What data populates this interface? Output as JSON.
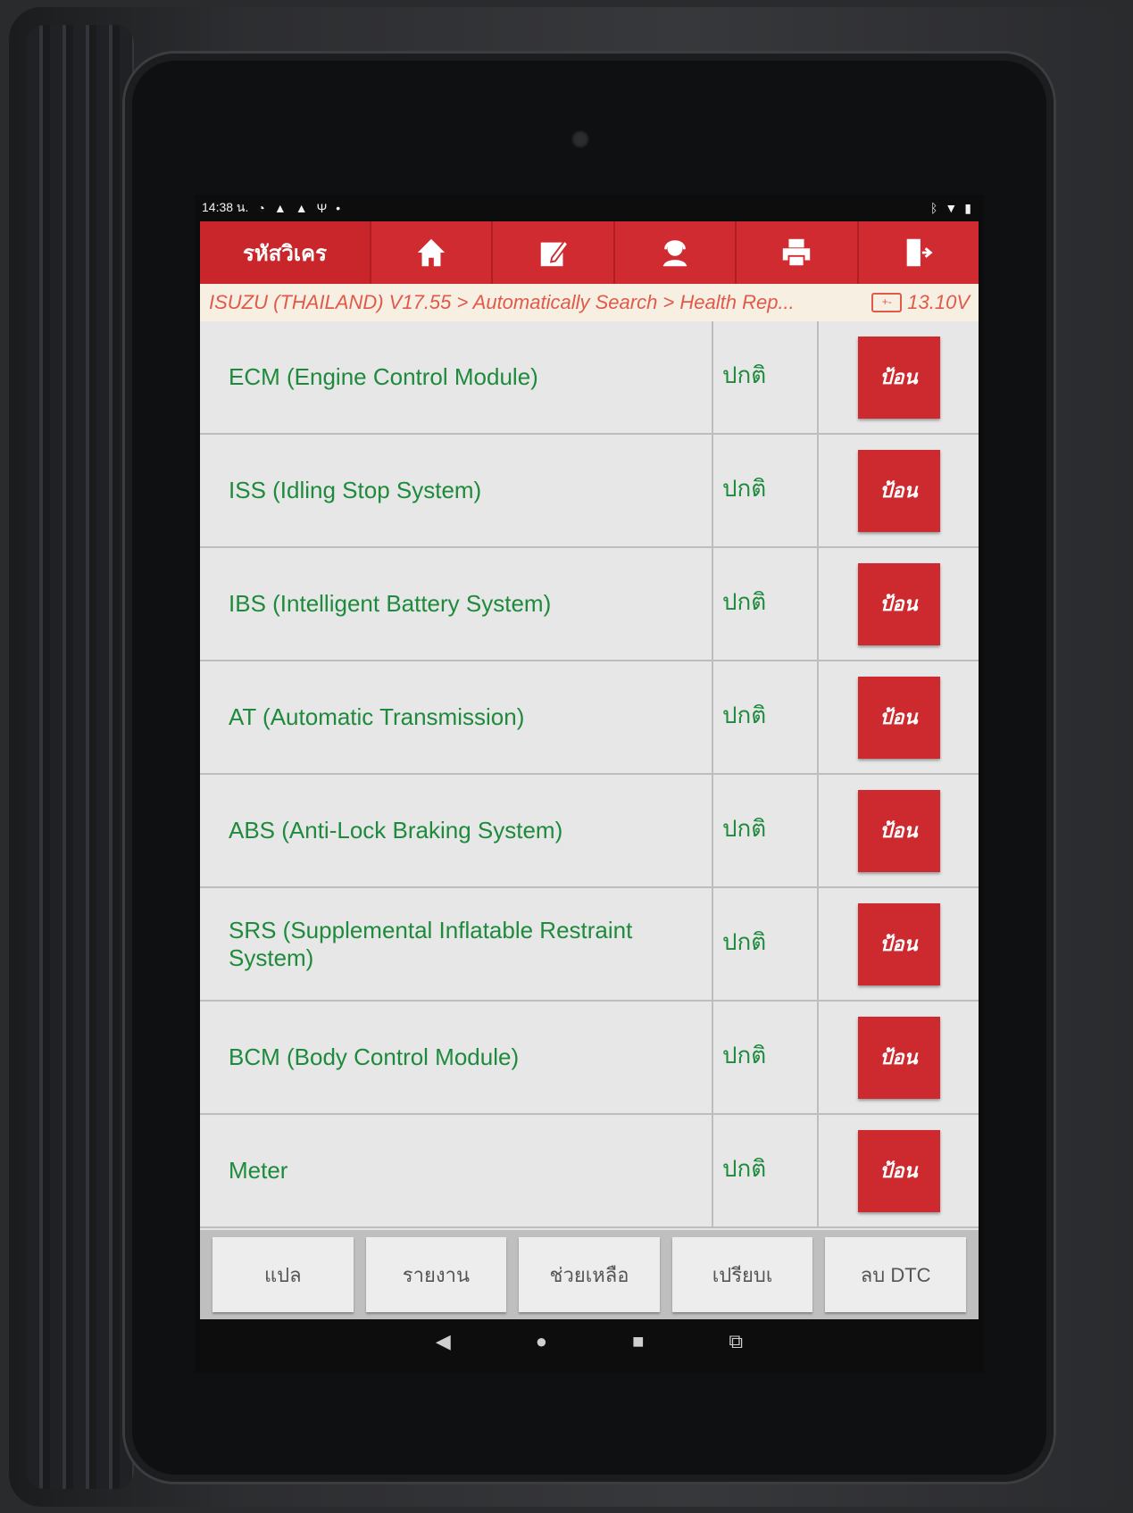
{
  "status_bar": {
    "time": "14:38 น.",
    "icons_left": [
      "clock-icon",
      "warning-icon",
      "warning-icon",
      "usb-icon",
      "dot-icon"
    ],
    "icons_right": [
      "bluetooth-icon",
      "wifi-icon",
      "battery-icon"
    ]
  },
  "header": {
    "title": "รหัสวิเคร",
    "buttons": [
      "home-icon",
      "edit-icon",
      "support-icon",
      "print-icon",
      "exit-icon"
    ]
  },
  "breadcrumb": {
    "path": "ISUZU (THAILAND) V17.55 > Automatically Search > Health Rep...",
    "voltage": "13.10V",
    "battery_glyph": "+-"
  },
  "modules": [
    {
      "name": "ECM (Engine Control Module)",
      "status": "ปกติ",
      "action": "ป้อน"
    },
    {
      "name": "ISS (Idling Stop System)",
      "status": "ปกติ",
      "action": "ป้อน"
    },
    {
      "name": "IBS (Intelligent Battery System)",
      "status": "ปกติ",
      "action": "ป้อน"
    },
    {
      "name": "AT (Automatic Transmission)",
      "status": "ปกติ",
      "action": "ป้อน"
    },
    {
      "name": "ABS (Anti-Lock Braking System)",
      "status": "ปกติ",
      "action": "ป้อน"
    },
    {
      "name": "SRS (Supplemental Inflatable Restraint System)",
      "status": "ปกติ",
      "action": "ป้อน"
    },
    {
      "name": "BCM (Body Control Module)",
      "status": "ปกติ",
      "action": "ป้อน"
    },
    {
      "name": "Meter",
      "status": "ปกติ",
      "action": "ป้อน"
    }
  ],
  "bottom_buttons": [
    "แปล",
    "รายงาน",
    "ช่วยเหลือ",
    "เปรียบเ",
    "ลบ DTC"
  ],
  "android_nav": {
    "back": "◀",
    "home": "●",
    "recents": "■",
    "screenshot": "⧉"
  },
  "colors": {
    "header_red": "#c8262b",
    "text_green": "#1e8a3c",
    "breadcrumb_orange": "#e05a4a"
  }
}
